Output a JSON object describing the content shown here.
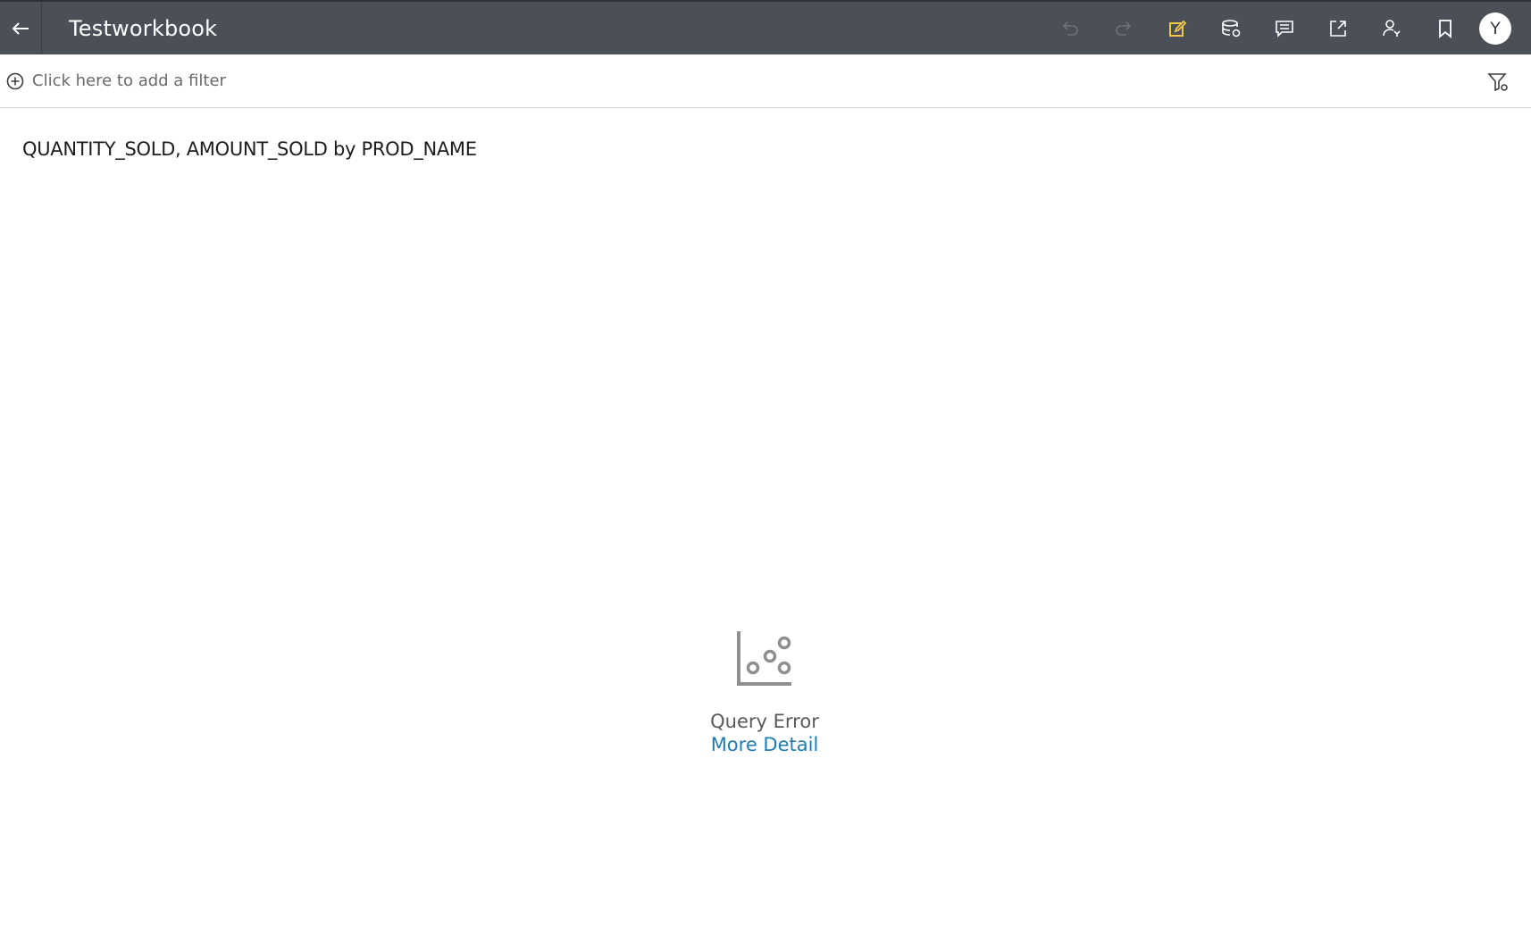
{
  "header": {
    "title": "Testworkbook",
    "avatar_initial": "Y",
    "icons": [
      "back-arrow-icon",
      "undo-icon",
      "redo-icon",
      "edit-icon",
      "data-refresh-icon",
      "comment-icon",
      "export-icon",
      "share-user-icon",
      "bookmark-icon"
    ]
  },
  "filterbar": {
    "add_filter_label": "Click here to add a filter"
  },
  "visualization": {
    "title": "QUANTITY_SOLD, AMOUNT_SOLD by PROD_NAME",
    "error_text": "Query Error",
    "more_detail_label": "More Detail"
  },
  "colors": {
    "topbar": "#4a4f58",
    "edit_accent": "#f0c94a",
    "link": "#1f7bb0",
    "icon_gray": "#8f8f8f"
  }
}
